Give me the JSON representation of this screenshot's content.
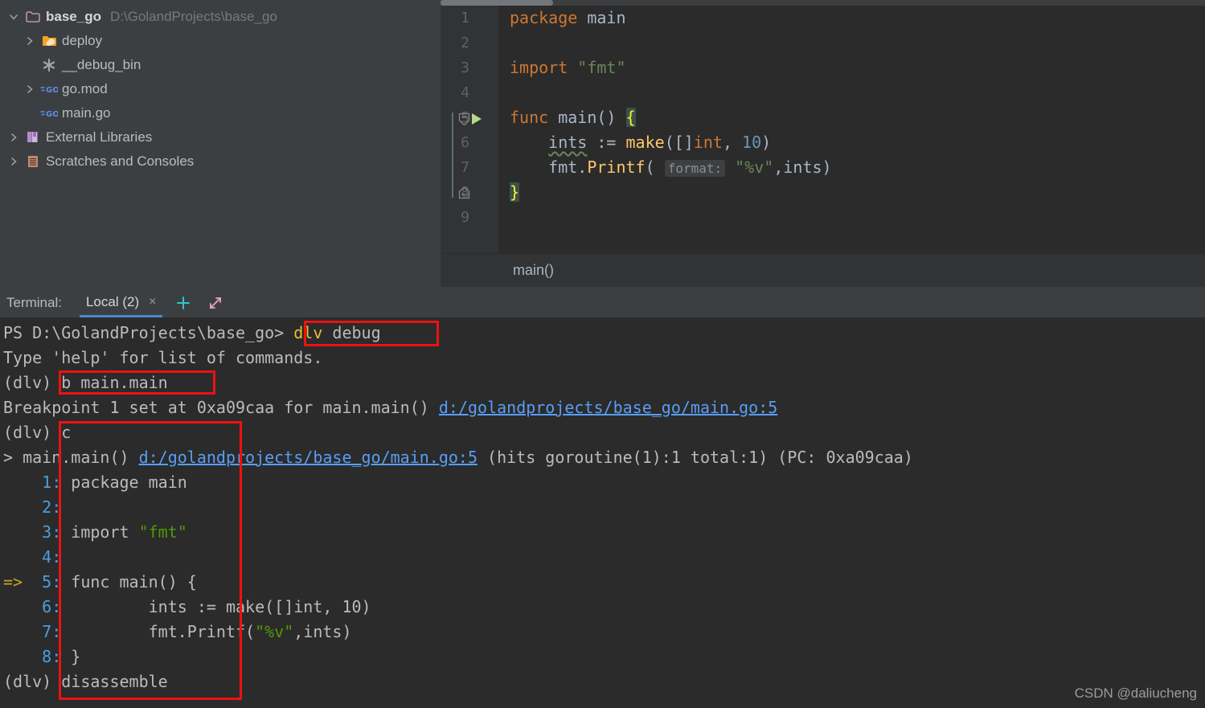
{
  "project_tree": {
    "items": [
      {
        "label": "base_go",
        "path": "D:\\GolandProjects\\base_go",
        "icon": "folder-open-icon",
        "arrow": "chevron-down-icon",
        "indent": 0,
        "bold": true
      },
      {
        "label": "deploy",
        "path": "",
        "icon": "folder-orange-icon",
        "arrow": "chevron-right-icon",
        "indent": 1,
        "bold": false
      },
      {
        "label": "__debug_bin",
        "path": "",
        "icon": "asterisk-icon",
        "arrow": "",
        "indent": 1,
        "bold": false
      },
      {
        "label": "go.mod",
        "path": "",
        "icon": "go-file-icon",
        "arrow": "chevron-right-icon",
        "indent": 1,
        "bold": false
      },
      {
        "label": "main.go",
        "path": "",
        "icon": "go-file-icon",
        "arrow": "",
        "indent": 1,
        "bold": false
      },
      {
        "label": "External Libraries",
        "path": "",
        "icon": "books-icon",
        "arrow": "chevron-right-icon",
        "indent": 0,
        "bold": false
      },
      {
        "label": "Scratches and Consoles",
        "path": "",
        "icon": "scratches-icon",
        "arrow": "chevron-right-icon",
        "indent": 0,
        "bold": false
      }
    ]
  },
  "editor": {
    "line_numbers": [
      "1",
      "2",
      "3",
      "4",
      "5",
      "6",
      "7",
      "8",
      "9"
    ],
    "breadcrumb": "main()",
    "code": {
      "l1_kw": "package",
      "l1_rest": " main",
      "l3_kw": "import",
      "l3_str": "\"fmt\"",
      "l5_kw": "func",
      "l5_name": " main",
      "l5_paren": "() ",
      "l5_brace": "{",
      "l6_var": "ints",
      "l6_assign": " := ",
      "l6_make": "make",
      "l6_open": "([]",
      "l6_int": "int",
      "l6_comma": ", ",
      "l6_num": "10",
      "l6_close": ")",
      "l7_pkg": "fmt.",
      "l7_fn": "Printf",
      "l7_open": "( ",
      "l7_hint": "format:",
      "l7_str": "\"%v\"",
      "l7_rest": ",ints)",
      "l8_brace": "}"
    }
  },
  "terminal": {
    "title": "Terminal:",
    "tab_label": "Local (2)",
    "tab_close": "×",
    "add_button": "+",
    "expand_button": "expand-icon",
    "lines": {
      "l1_prompt": "PS D:\\GolandProjects\\base_go> ",
      "l1_cmd": "dlv",
      "l1_cmd2": " debug",
      "l2": "Type 'help' for list of commands.",
      "l3_prompt": "(dlv) ",
      "l3_cmd": "b main.main",
      "l4_text": "Breakpoint 1 set at 0xa09caa for main.main() ",
      "l4_link": "d:/golandprojects/base_go/main.go:5",
      "l5_prompt": "(dlv) ",
      "l5_cmd": "c",
      "l6_pre": "> main.main() ",
      "l6_link": "d:/golandprojects/base_go/main.go:5",
      "l6_post": " (hits goroutine(1):1 total:1) (PC: 0xa09caa)",
      "code_listing": [
        {
          "arrow": "",
          "num": "1:",
          "text": " package main",
          "str": ""
        },
        {
          "arrow": "",
          "num": "2:",
          "text": "",
          "str": ""
        },
        {
          "arrow": "",
          "num": "3:",
          "text": " import ",
          "str": "\"fmt\""
        },
        {
          "arrow": "",
          "num": "4:",
          "text": "",
          "str": ""
        },
        {
          "arrow": "=>",
          "num": "5:",
          "text": " func main() {",
          "str": ""
        },
        {
          "arrow": "",
          "num": "6:",
          "text": "         ints := make([]int, 10)",
          "str": ""
        },
        {
          "arrow": "",
          "num": "7:",
          "text": "         fmt.Printf(",
          "str": "\"%v\"",
          "tail": ",ints)"
        },
        {
          "arrow": "",
          "num": "8:",
          "text": " }",
          "str": ""
        }
      ],
      "l_last_prompt": "(dlv) ",
      "l_last_cmd": "disassemble"
    }
  },
  "watermark": "CSDN @daliucheng",
  "colors": {
    "accent_red": "#ee1111",
    "tab_underline": "#4a88c7",
    "keyword": "#cc7832",
    "string": "#6a8759",
    "function": "#ffc66d",
    "link": "#589df6"
  }
}
